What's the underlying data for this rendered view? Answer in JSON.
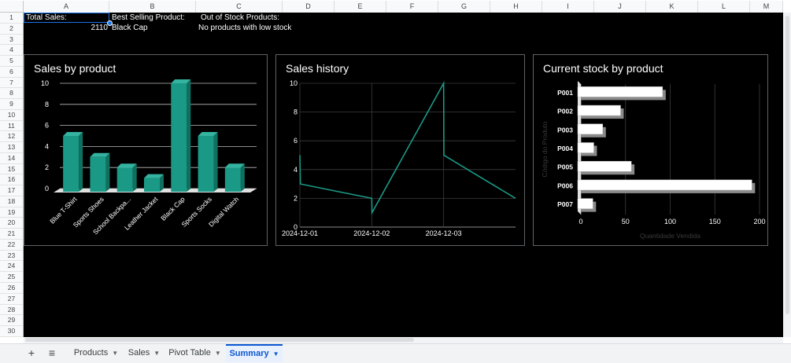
{
  "columns": [
    "A",
    "B",
    "C",
    "D",
    "E",
    "F",
    "G",
    "H",
    "I",
    "J",
    "K",
    "L",
    "M"
  ],
  "rows": [
    "1",
    "2",
    "3",
    "4",
    "5",
    "6",
    "7",
    "8",
    "9",
    "10",
    "11",
    "12",
    "13",
    "14",
    "15",
    "16",
    "17",
    "18",
    "19",
    "20",
    "21",
    "22",
    "23",
    "24",
    "25",
    "26",
    "27",
    "28",
    "29",
    "30"
  ],
  "cells": {
    "a1": "Total Sales:",
    "b1": "Best Selling Product:",
    "c1": "Out of Stock Products:",
    "a2": "2110",
    "b2": "Black Cap",
    "c2": "No products with low stock"
  },
  "colors": {
    "grid_background": "#000000",
    "series_teal": "#1a9a86",
    "selection": "#1a73e8",
    "bar_white": "#ffffff"
  },
  "chart_data": [
    {
      "type": "bar",
      "title": "Sales by product",
      "categories": [
        "Blue T-Shirt",
        "Sports Shoes",
        "School Backpa...",
        "Leather Jacket",
        "Black Cap",
        "Sports Socks",
        "Digital Watch"
      ],
      "values": [
        5,
        3,
        2,
        1,
        10,
        5,
        2
      ],
      "yticks": [
        "0",
        "2",
        "4",
        "6",
        "8",
        "10"
      ],
      "ylim": [
        0,
        10
      ],
      "grid": true,
      "style": "3d"
    },
    {
      "type": "line",
      "title": "Sales history",
      "points": [
        {
          "x": "2024-12-01 00:00",
          "y": 5
        },
        {
          "x": "2024-12-01 00:10",
          "y": 3
        },
        {
          "x": "2024-12-01 12:00",
          "y": 2.5
        },
        {
          "x": "2024-12-02 00:00",
          "y": 2
        },
        {
          "x": "2024-12-02 00:05",
          "y": 1
        },
        {
          "x": "2024-12-03 00:00",
          "y": 10
        },
        {
          "x": "2024-12-03 00:05",
          "y": 5
        },
        {
          "x": "2024-12-03 12:00",
          "y": 3.5
        },
        {
          "x": "2024-12-04 00:00",
          "y": 2
        }
      ],
      "xticks": [
        "2024-12-01",
        "2024-12-02",
        "2024-12-03"
      ],
      "yticks": [
        "0",
        "2",
        "4",
        "6",
        "8",
        "10"
      ],
      "ylim": [
        0,
        10
      ],
      "grid": true
    },
    {
      "type": "bar",
      "orientation": "horizontal",
      "title": "Current stock by product",
      "categories": [
        "P001",
        "P002",
        "P003",
        "P004",
        "P005",
        "P006",
        "P007"
      ],
      "values": [
        95,
        48,
        28,
        18,
        60,
        195,
        17
      ],
      "xticks": [
        "0",
        "50",
        "100",
        "150",
        "200"
      ],
      "xlim": [
        0,
        200
      ],
      "xlabel": "Quantidade Vendida",
      "ylabel": "Código do Produto",
      "grid": true,
      "style": "3d"
    }
  ],
  "tabs": {
    "add_icon": "+",
    "menu_icon": "≡",
    "items": [
      {
        "label": "Products",
        "active": false
      },
      {
        "label": "Sales",
        "active": false
      },
      {
        "label": "Pivot Table",
        "active": false
      },
      {
        "label": "Summary",
        "active": true
      }
    ]
  }
}
